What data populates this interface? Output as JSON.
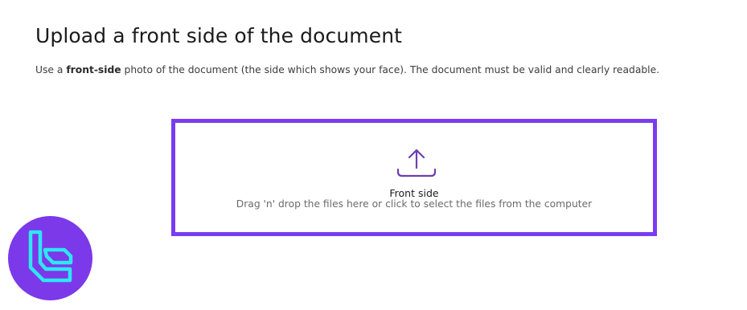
{
  "header": {
    "title": "Upload a front side of the document",
    "description_prefix": "Use a ",
    "description_bold": "front-side",
    "description_suffix": " photo of the document (the side which shows your face). The document must be valid and clearly readable."
  },
  "dropzone": {
    "label": "Front side",
    "hint": "Drag 'n' drop the files here or click to select the files from the computer",
    "icon": "upload-icon"
  },
  "logo": {
    "icon": "brand-logo"
  },
  "colors": {
    "accent": "#7a3cf0",
    "icon": "#6c3fb0",
    "logo_bg": "#7b39ea",
    "logo_mark": "#2fe6f3"
  }
}
